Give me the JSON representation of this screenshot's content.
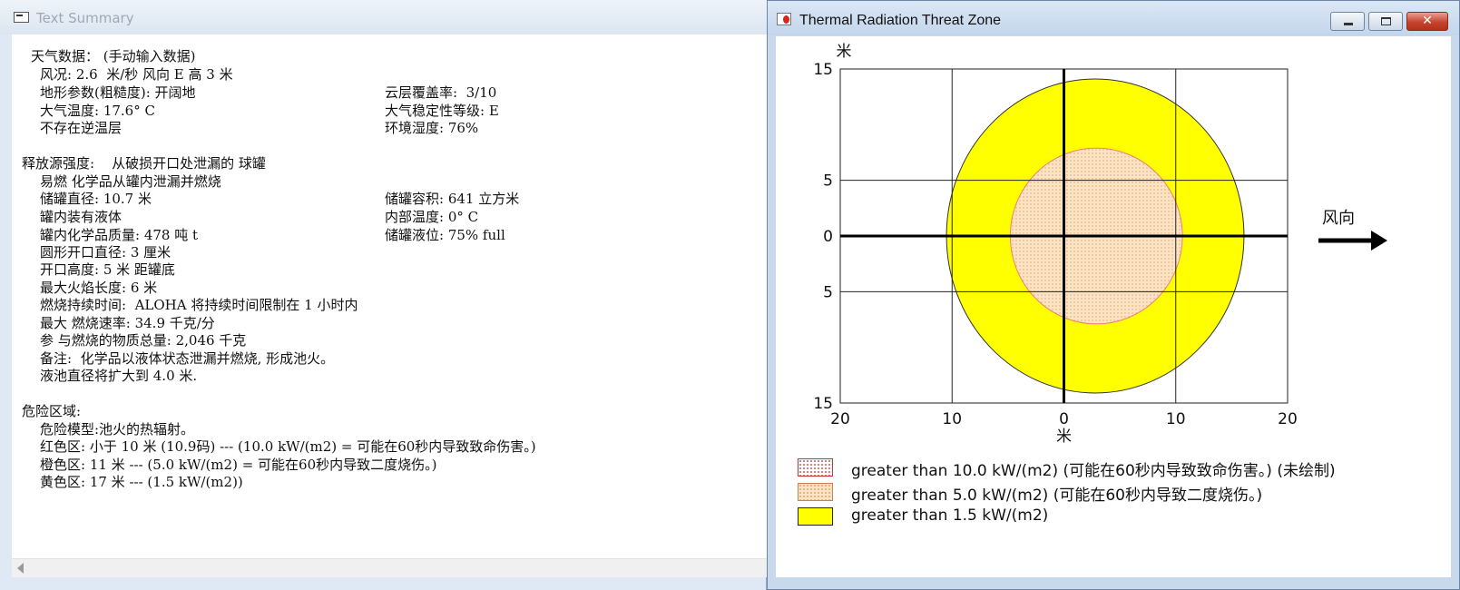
{
  "left_window": {
    "title": "Text Summary",
    "lines": [
      "天气数据： (手动输入数据)",
      "风况: 2.6  米/秒 风向 E 高 3 米",
      "地形参数(粗糙度): 开阔地",
      "云层覆盖率:  3/10",
      "大气温度: 17.6° C",
      "大气稳定性等级: E",
      "不存在逆温层",
      "环境湿度: 76%",
      "释放源强度:    从破损开口处泄漏的 球罐",
      "易燃 化学品从罐内泄漏并燃烧",
      "储罐直径: 10.7 米",
      "储罐容积: 641 立方米",
      "罐内装有液体",
      "内部温度: 0° C",
      "罐内化学品质量: 478 吨 t",
      "储罐液位: 75% full",
      "圆形开口直径: 3 厘米",
      "开口高度: 5 米 距罐底",
      "最大火焰长度: 6 米",
      "燃烧持续时间:  ALOHA 将持续时间限制在 1 小时内",
      "最大 燃烧速率: 34.9 千克/分",
      "参 与燃烧的物质总量: 2,046 千克",
      "备注:  化学品以液体状态泄漏并燃烧, 形成池火。",
      "液池直径将扩大到 4.0 米.",
      "危险区域:",
      "危险模型:池火的热辐射。",
      "红色区: 小于 10 米 (10.9码) --- (10.0 kW/(m2) = 可能在60秒内导致致命伤害。)",
      "橙色区: 11 米 --- (5.0 kW/(m2) = 可能在60秒内导致二度烧伤。)",
      "黄色区: 17 米 --- (1.5 kW/(m2))"
    ]
  },
  "right_window": {
    "title": "Thermal Radiation Threat Zone",
    "buttons": {
      "minimize": "—",
      "maximize": "□",
      "close": "✕"
    },
    "wind_label": "风向",
    "legend": [
      {
        "text": "greater than 10.0 kW/(m2) (可能在60秒内导致致命伤害。) (未绘制)",
        "fill": "#ffffff",
        "dot": "#e05050",
        "border": "#d03030"
      },
      {
        "text": "greater than 5.0 kW/(m2) (可能在60秒内导致二度烧伤。)",
        "fill": "#fbe4c4",
        "dot": "#e8a070",
        "border": "#d08050"
      },
      {
        "text": "greater than 1.5 kW/(m2)",
        "fill": "#ffff00",
        "dot": "",
        "border": "#222222"
      }
    ]
  },
  "chart_data": {
    "type": "map",
    "x_unit_label": "米",
    "y_unit_label": "米",
    "xlim": [
      -20,
      20
    ],
    "ylim": [
      -15,
      15
    ],
    "x_ticks": [
      -20,
      -10,
      0,
      10,
      20
    ],
    "x_tick_labels": [
      "20",
      "10",
      "0",
      "10",
      "20"
    ],
    "y_ticks": [
      15,
      5,
      0,
      -5,
      -15
    ],
    "y_tick_labels": [
      "15",
      "5",
      "0",
      "5",
      "15"
    ],
    "grid": true,
    "zones": [
      {
        "name": "yellow",
        "threshold": "1.5 kW/(m2)",
        "center_x": 2.8,
        "center_y": 0,
        "rx": 13.3,
        "ry": 14.1,
        "color": "#ffff00"
      },
      {
        "name": "orange",
        "threshold": "5.0 kW/(m2)",
        "center_x": 2.9,
        "center_y": 0,
        "rx": 7.7,
        "ry": 7.9,
        "color": "#fbe4c4"
      }
    ],
    "wind_direction": "east"
  }
}
